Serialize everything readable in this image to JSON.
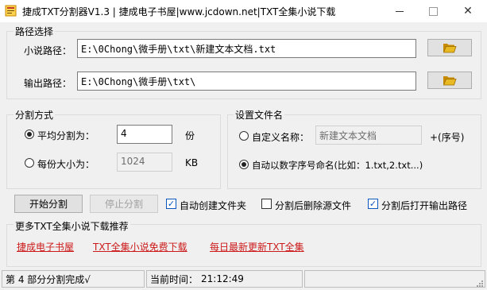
{
  "window": {
    "title": "捷成TXT分割器V1.3 | 捷成电子书屋|www.jcdown.net|TXT全集小说下载",
    "minimize_glyph": "—",
    "close_glyph": "✕"
  },
  "path_group": {
    "title": "路径选择",
    "novel_label": "小说路径：",
    "novel_value": "E:\\0Chong\\微手册\\txt\\新建文本文档.txt",
    "output_label": "输出路径：",
    "output_value": "E:\\0Chong\\微手册\\txt\\",
    "browse_icon": "folder-open-icon"
  },
  "split_group": {
    "title": "分割方式",
    "avg_label": "平均分割为：",
    "avg_value": "4",
    "avg_unit": "份",
    "size_label": "每份大小为：",
    "size_value": "1024",
    "size_unit": "KB",
    "selected": "avg"
  },
  "name_group": {
    "title": "设置文件名",
    "custom_label": "自定义名称：",
    "custom_value": "新建文本文档",
    "custom_suffix": "+(序号)",
    "auto_label": "自动以数字序号命名(比如：1.txt,2.txt...)",
    "selected": "auto"
  },
  "actions": {
    "start_label": "开始分割",
    "stop_label": "停止分割",
    "opt_create_folder": "自动创建文件夹",
    "opt_delete_source": "分割后删除源文件",
    "opt_open_output": "分割后打开输出路径",
    "create_folder_checked": true,
    "delete_source_checked": false,
    "open_output_checked": true
  },
  "recommend": {
    "title": "更多TXT全集小说下载推荐",
    "links": [
      "捷成电子书屋",
      "TXT全集小说免费下载",
      "每日最新更新TXT全集"
    ]
  },
  "status": {
    "progress_text": "第 4 部分分割完成√",
    "time_label": "当前时间：",
    "time_value": "21:12:49"
  },
  "colors": {
    "link": "#cc1a1a",
    "check_accent": "#0a57c0",
    "folder": "#e8b923"
  }
}
